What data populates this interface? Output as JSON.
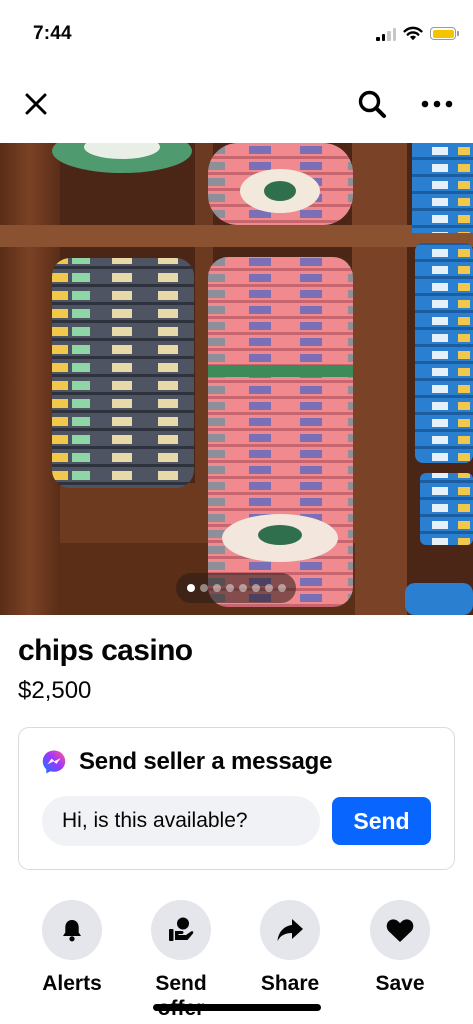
{
  "status_bar": {
    "time": "7:44",
    "icons": [
      "cellular-signal-icon",
      "wifi-icon",
      "battery-icon"
    ],
    "battery_color": "#f5c400"
  },
  "top_nav": {
    "icons": [
      "close-icon",
      "search-icon",
      "more-icon"
    ]
  },
  "gallery": {
    "image_count": 8,
    "active_index": 0
  },
  "listing": {
    "title": "chips casino",
    "price": "$2,500"
  },
  "message_card": {
    "icon": "messenger-icon",
    "title": "Send seller a message",
    "input_value": "Hi, is this available?",
    "send_label": "Send",
    "send_color": "#0866ff"
  },
  "actions": [
    {
      "label": "Alerts",
      "icon": "bell-icon"
    },
    {
      "label": "Send offer",
      "icon": "offer-icon"
    },
    {
      "label": "Share",
      "icon": "share-icon"
    },
    {
      "label": "Save",
      "icon": "heart-icon"
    }
  ]
}
